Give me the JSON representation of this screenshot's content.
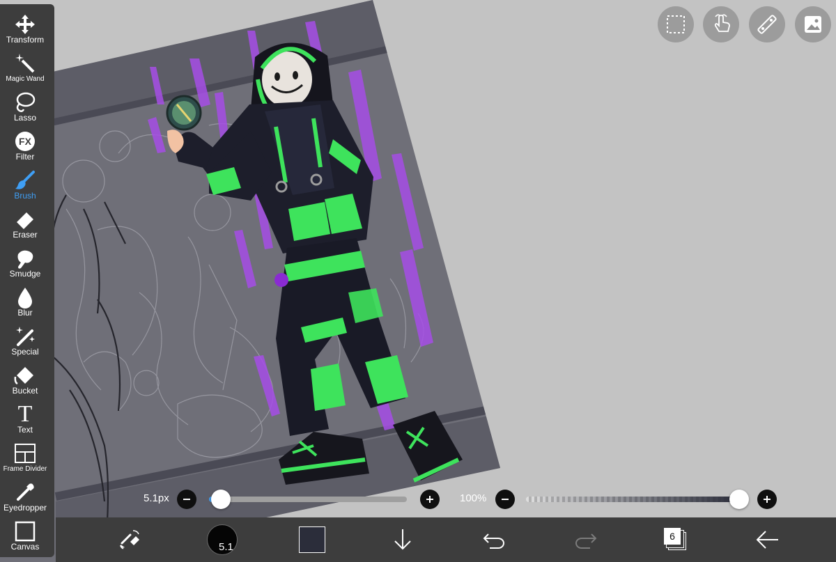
{
  "app": {
    "accent_color": "#3f9ff5",
    "toolbar_color": "#3d3d3d"
  },
  "toolbar": {
    "tools": [
      {
        "id": "transform",
        "label": "Transform",
        "icon": "move-arrows-icon",
        "active": false
      },
      {
        "id": "magic-wand",
        "label": "Magic Wand",
        "icon": "magic-wand-icon",
        "active": false
      },
      {
        "id": "lasso",
        "label": "Lasso",
        "icon": "lasso-icon",
        "active": false
      },
      {
        "id": "filter",
        "label": "Filter",
        "icon": "fx-icon",
        "icon_text": "FX",
        "active": false
      },
      {
        "id": "brush",
        "label": "Brush",
        "icon": "brush-icon",
        "active": true
      },
      {
        "id": "eraser",
        "label": "Eraser",
        "icon": "eraser-icon",
        "active": false
      },
      {
        "id": "smudge",
        "label": "Smudge",
        "icon": "smudge-finger-icon",
        "active": false
      },
      {
        "id": "blur",
        "label": "Blur",
        "icon": "water-drop-icon",
        "active": false
      },
      {
        "id": "special",
        "label": "Special",
        "icon": "sparkle-pen-icon",
        "active": false
      },
      {
        "id": "bucket",
        "label": "Bucket",
        "icon": "paint-bucket-icon",
        "active": false
      },
      {
        "id": "text",
        "label": "Text",
        "icon": "text-T-icon",
        "icon_text": "T",
        "active": false
      },
      {
        "id": "frame-divider",
        "label": "Frame Divider",
        "icon": "frame-divider-icon",
        "active": false
      },
      {
        "id": "eyedropper",
        "label": "Eyedropper",
        "icon": "eyedropper-icon",
        "active": false
      },
      {
        "id": "canvas",
        "label": "Canvas",
        "icon": "canvas-square-icon",
        "active": false
      }
    ]
  },
  "top_buttons": [
    {
      "id": "selection",
      "icon": "dashed-selection-icon"
    },
    {
      "id": "gesture",
      "icon": "hand-touch-icon"
    },
    {
      "id": "ruler",
      "icon": "ruler-icon"
    },
    {
      "id": "reference",
      "icon": "image-reference-icon"
    }
  ],
  "brush_size": {
    "label": "5.1px",
    "value_fraction": 0.06
  },
  "opacity": {
    "label": "100%",
    "value_fraction": 1.0
  },
  "bottom_bar": {
    "brush_size_text": "5.1",
    "current_color": "#2b2d3a",
    "layer_count": "6",
    "icons": [
      "brush-eraser-swap-icon",
      "brush-size-icon",
      "color-swatch-icon",
      "download-arrow-icon",
      "undo-icon",
      "redo-icon",
      "layers-icon",
      "back-arrow-icon"
    ]
  }
}
